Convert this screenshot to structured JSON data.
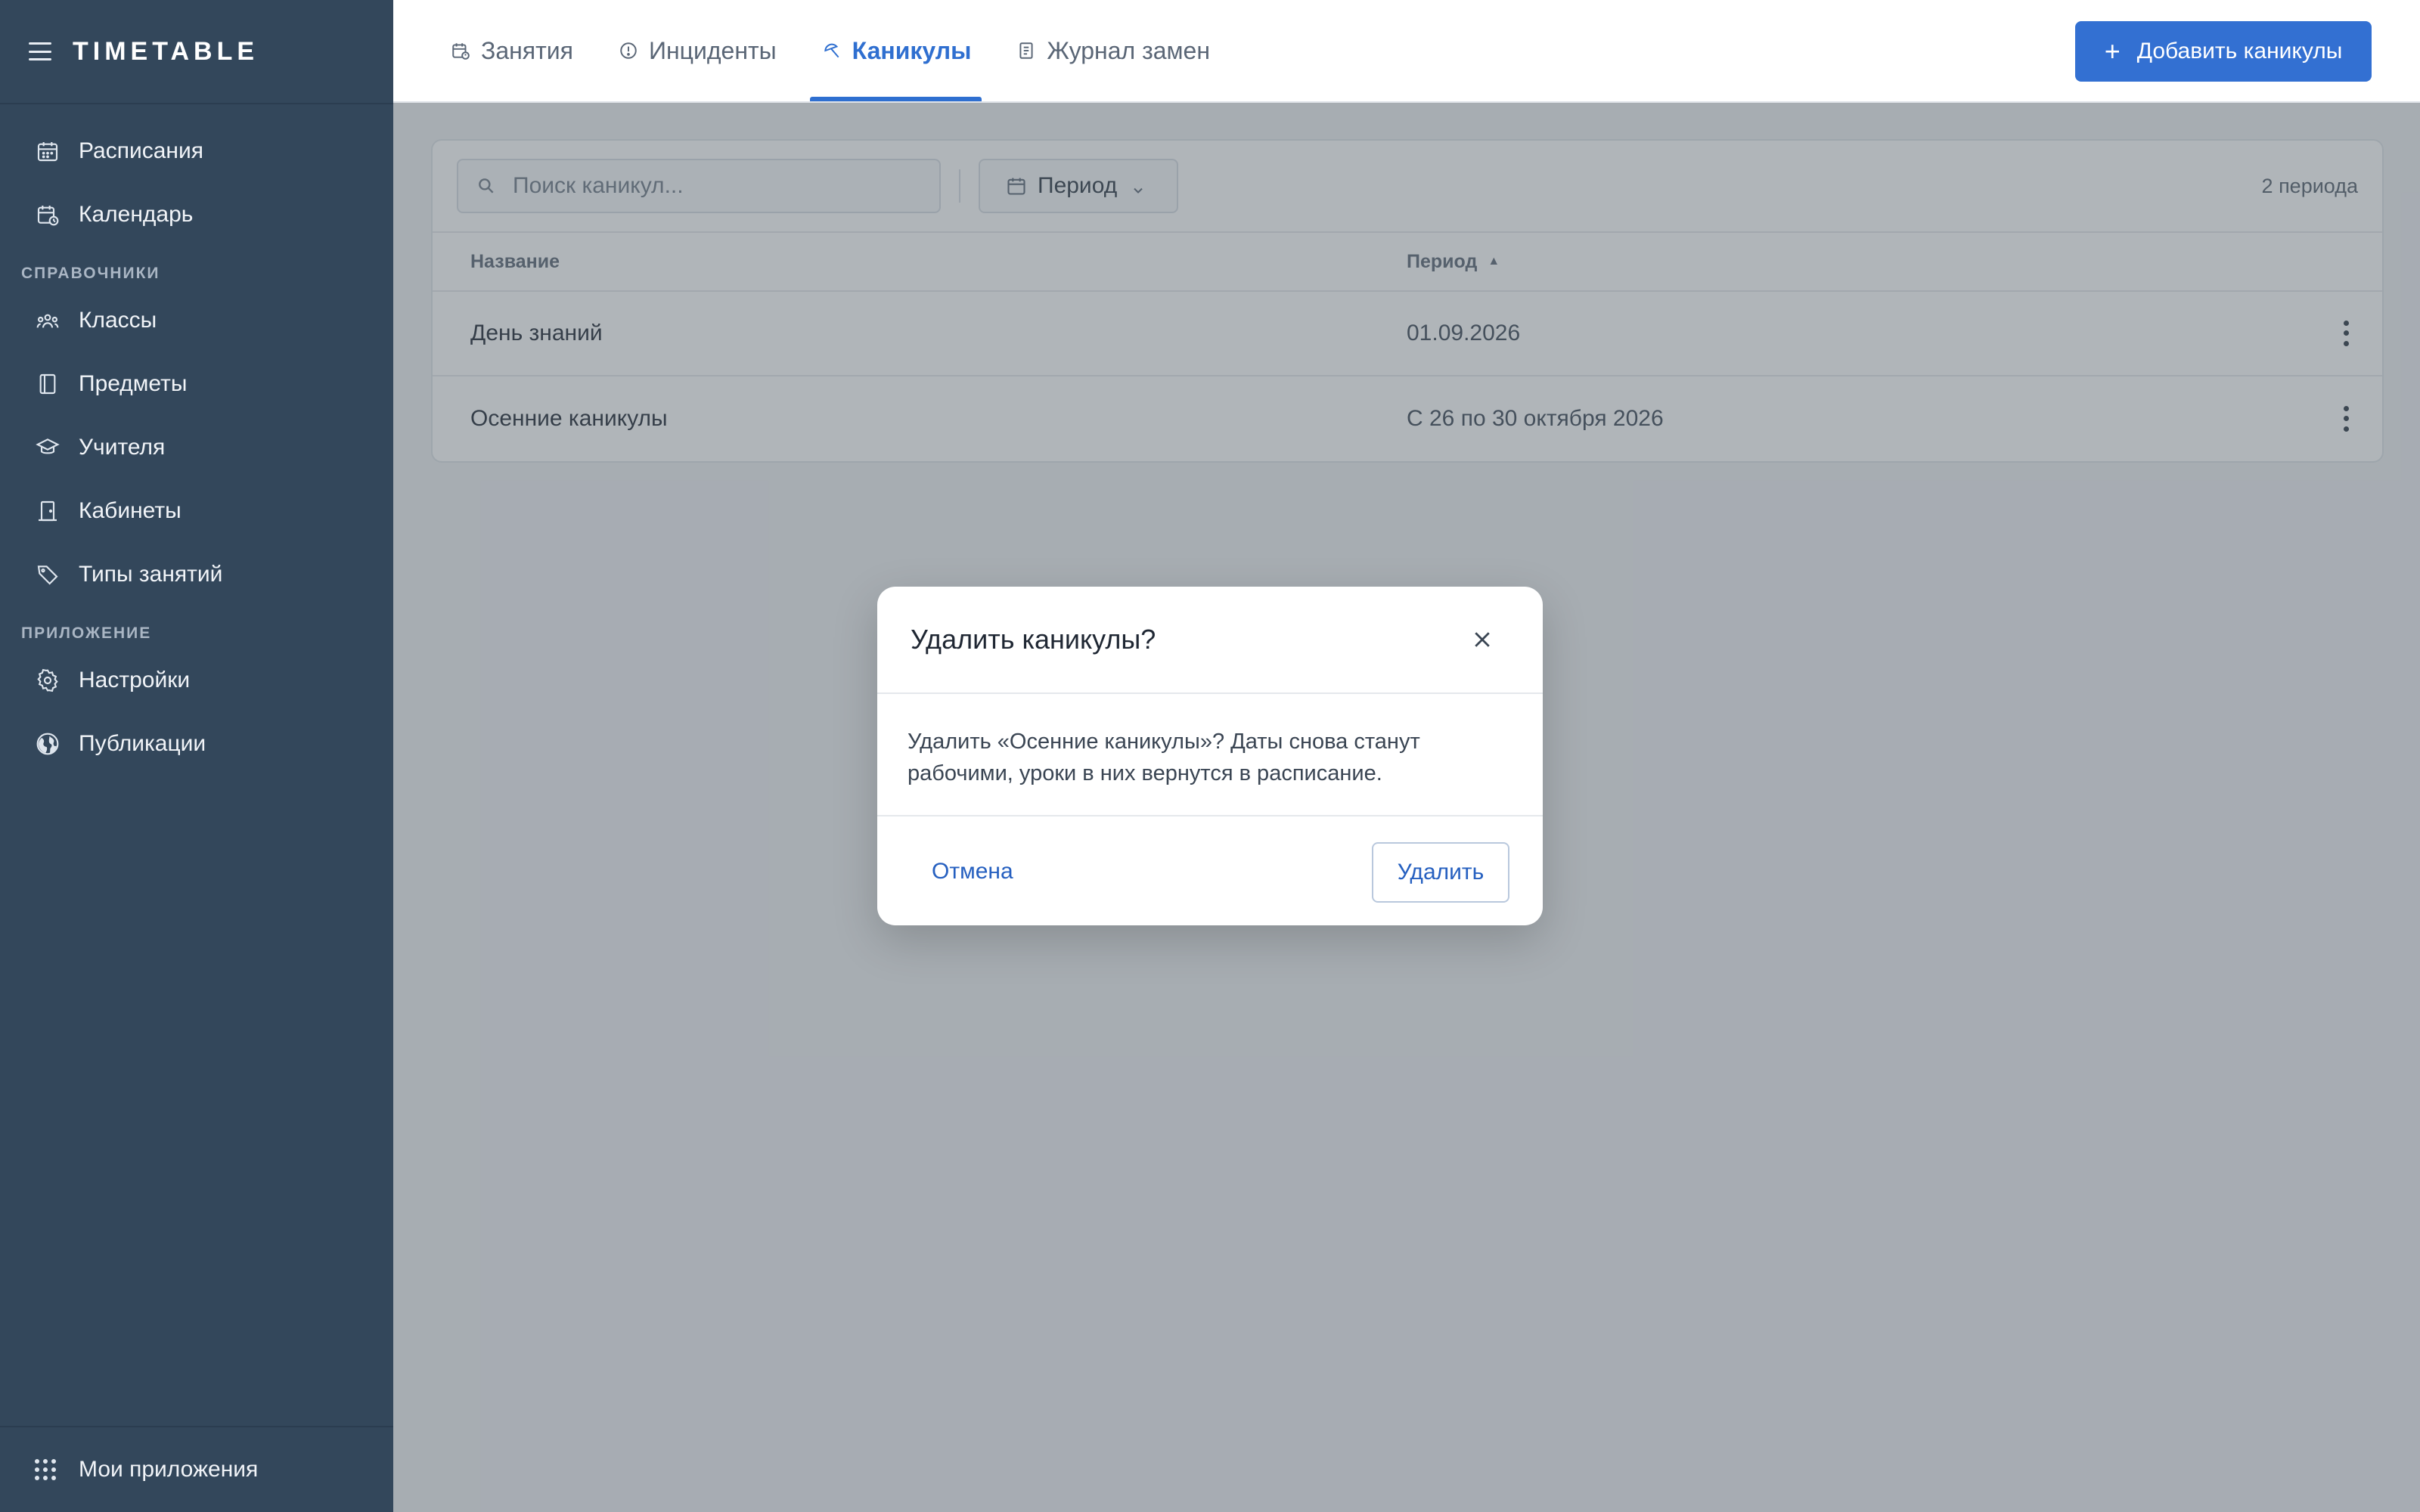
{
  "app": {
    "brand": "TIMETABLE"
  },
  "sidebar": {
    "items_top": [
      {
        "label": "Расписания",
        "icon": "calendar-grid-icon"
      },
      {
        "label": "Календарь",
        "icon": "calendar-clock-icon"
      }
    ],
    "section_refs": "СПРАВОЧНИКИ",
    "items_refs": [
      {
        "label": "Классы",
        "icon": "group-icon"
      },
      {
        "label": "Предметы",
        "icon": "book-icon"
      },
      {
        "label": "Учителя",
        "icon": "graduation-cap-icon"
      },
      {
        "label": "Кабинеты",
        "icon": "door-icon"
      },
      {
        "label": "Типы занятий",
        "icon": "tag-icon"
      }
    ],
    "section_app": "ПРИЛОЖЕНИЕ",
    "items_app": [
      {
        "label": "Настройки",
        "icon": "gear-icon"
      },
      {
        "label": "Публикации",
        "icon": "globe-icon"
      }
    ],
    "footer": {
      "label": "Мои приложения",
      "icon": "apps-grid-icon"
    }
  },
  "topbar": {
    "tabs": [
      {
        "label": "Занятия",
        "icon": "calendar-clock-icon",
        "active": false
      },
      {
        "label": "Инциденты",
        "icon": "alert-circle-icon",
        "active": false
      },
      {
        "label": "Каникулы",
        "icon": "beach-umbrella-icon",
        "active": true
      },
      {
        "label": "Журнал замен",
        "icon": "journal-icon",
        "active": false
      }
    ],
    "add_button": "Добавить каникулы"
  },
  "toolbar": {
    "search_placeholder": "Поиск каникул...",
    "period_button": "Период",
    "count": "2 периода"
  },
  "table": {
    "columns": {
      "name": "Название",
      "period": "Период"
    },
    "rows": [
      {
        "name": "День знаний",
        "period": "01.09.2026"
      },
      {
        "name": "Осенние каникулы",
        "period": "С 26 по 30 октября 2026"
      }
    ]
  },
  "modal": {
    "title": "Удалить каникулы?",
    "body": "Удалить «Осенние каникулы»? Даты снова станут рабочими, уроки в них вернутся в расписание.",
    "cancel": "Отмена",
    "confirm": "Удалить"
  },
  "colors": {
    "sidebar_bg": "#33475b",
    "accent": "#3370d2",
    "overlay": "rgba(80,90,100,0.45)"
  }
}
